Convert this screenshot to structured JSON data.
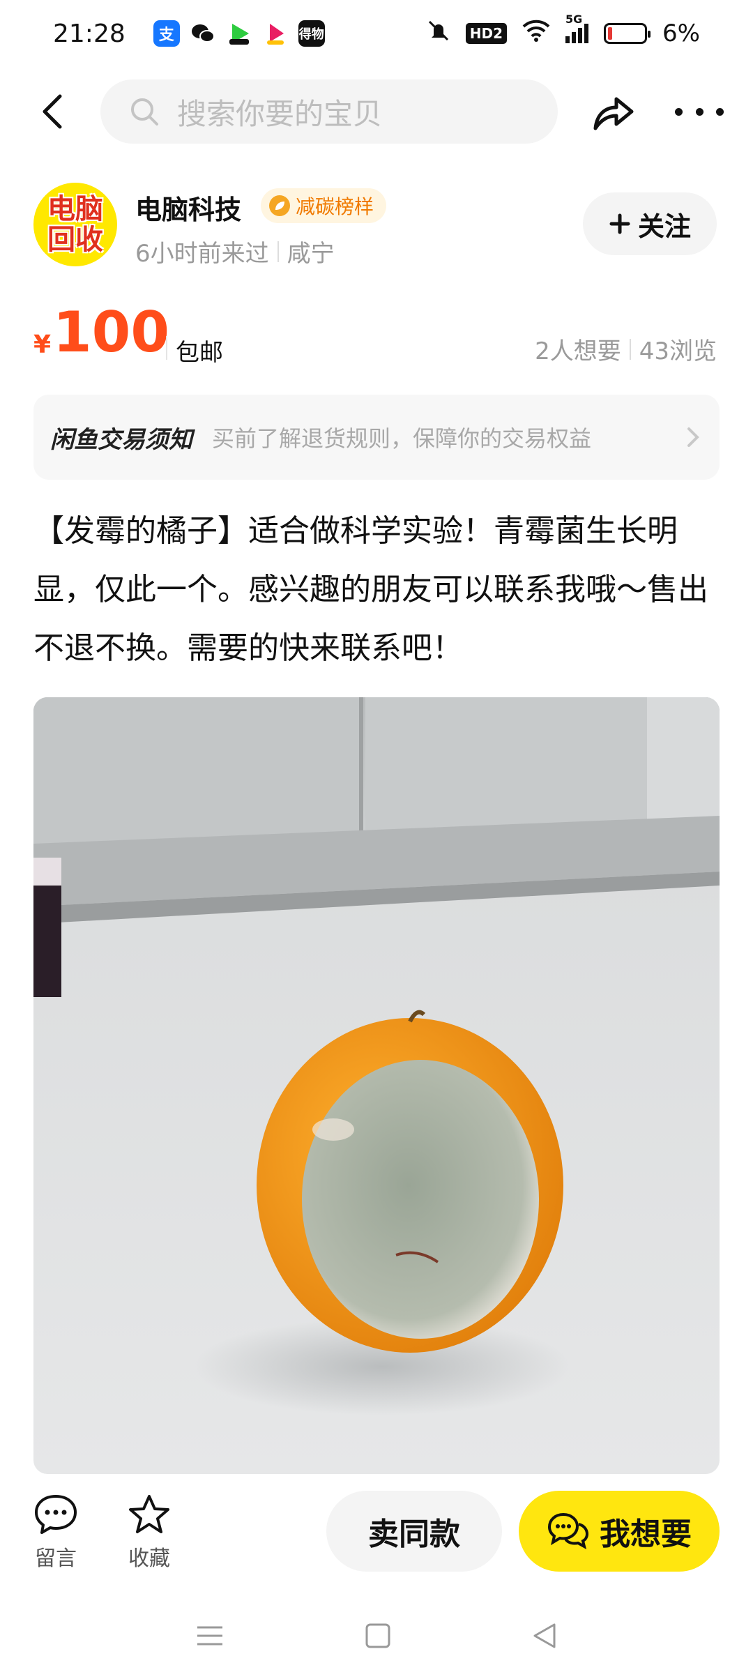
{
  "status_bar": {
    "time": "21:28",
    "hd_label": "HD2",
    "network_label": "5G",
    "battery_text": "6%",
    "battery_level": 0.06
  },
  "header": {
    "search_placeholder": "搜索你要的宝贝"
  },
  "seller": {
    "avatar_line1": "电脑",
    "avatar_line2": "回收",
    "name": "电脑科技",
    "badge": "减碳榜样",
    "last_seen": "6小时前来过",
    "location": "咸宁",
    "follow_label": "关注"
  },
  "price": {
    "currency": "¥",
    "amount": "100",
    "shipping": "包邮",
    "wants": "2人想要",
    "views": "43浏览"
  },
  "notice": {
    "title": "闲鱼交易须知",
    "text": "买前了解退货规则，保障你的交易权益"
  },
  "description": "【发霉的橘子】适合做科学实验！青霉菌生长明显，仅此一个。感兴趣的朋友可以联系我哦～售出不退不换。需要的快来联系吧！",
  "bottom_bar": {
    "comment_label": "留言",
    "favorite_label": "收藏",
    "sell_same_label": "卖同款",
    "want_label": "我想要"
  },
  "colors": {
    "price": "#ff4d1a",
    "want_button": "#ffe60f",
    "badge_text": "#f07a00"
  }
}
